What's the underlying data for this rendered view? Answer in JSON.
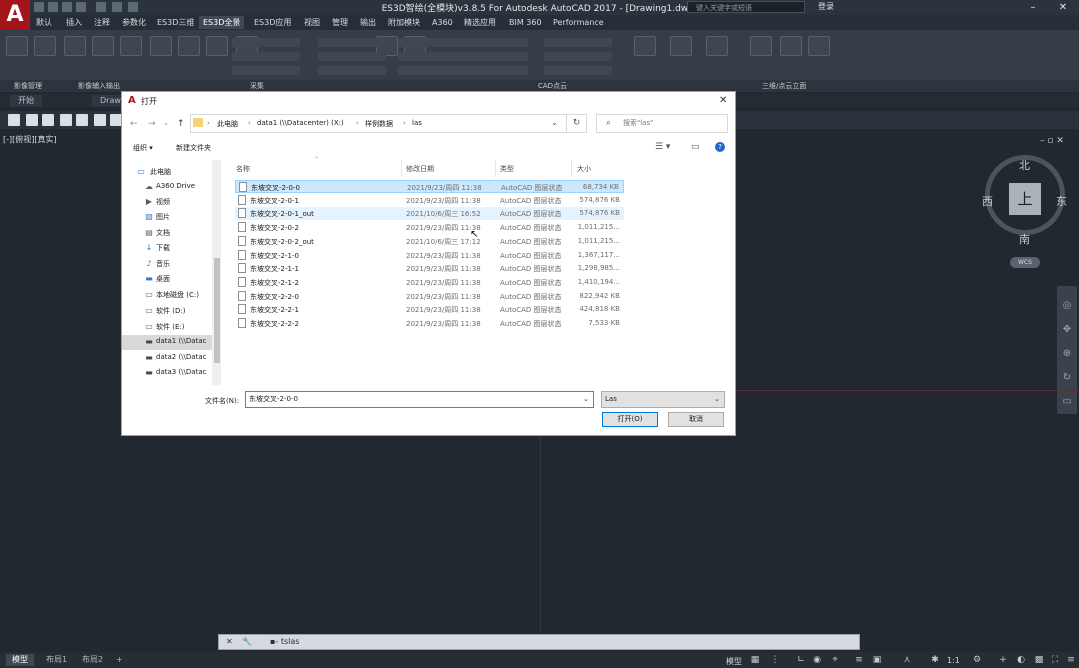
{
  "app": {
    "window_title": "ES3D智绘(全模块)v3.8.5 For Autodesk AutoCAD 2017 - [Drawing1.dwg]",
    "search_placeholder": "键入关键字或短语",
    "login_label": "登录",
    "logo_letter": "A"
  },
  "ribbon_tabs": [
    "默认",
    "插入",
    "注释",
    "参数化",
    "ES3D三维",
    "ES3D全景",
    "ES3D应用",
    "视图",
    "管理",
    "输出",
    "附加模块",
    "A360",
    "精选应用",
    "BIM 360",
    "Performance"
  ],
  "active_ribbon_tab": "ES3D全景",
  "ribbon_panels": [
    "影像管理",
    "影像辅入输出",
    "采集",
    "CAD点云",
    "三维/点云立面"
  ],
  "file_tabs": [
    "开始",
    "Drawing1"
  ],
  "viewport_label": "[-][俯视][真实]",
  "viewcube": {
    "face": "上",
    "north": "北",
    "south": "南",
    "east": "东",
    "west": "西",
    "wcs": "WCS"
  },
  "command_line": "▪- tslas",
  "status_tabs": [
    "模型",
    "布局1",
    "布局2",
    "+"
  ],
  "status_model_label": "模型",
  "status_scale": "1:1",
  "dialog": {
    "title": "打开",
    "breadcrumbs": [
      "此电脑",
      "data1 (\\\\Datacenter) (X:)",
      "样例数据",
      "las"
    ],
    "search_placeholder": "搜索\"las\"",
    "organize_label": "组织 ▾",
    "new_folder_label": "新建文件夹",
    "columns": {
      "name": "名称",
      "date": "修改日期",
      "type": "类型",
      "size": "大小"
    },
    "tree": [
      {
        "label": "此电脑",
        "icon": "computer-icon",
        "selected": false
      },
      {
        "label": "A360 Drive",
        "icon": "cloud-icon",
        "selected": false
      },
      {
        "label": "视频",
        "icon": "video-icon",
        "selected": false
      },
      {
        "label": "图片",
        "icon": "picture-icon",
        "selected": false
      },
      {
        "label": "文档",
        "icon": "document-icon",
        "selected": false
      },
      {
        "label": "下载",
        "icon": "download-icon",
        "selected": false
      },
      {
        "label": "音乐",
        "icon": "music-icon",
        "selected": false
      },
      {
        "label": "桌面",
        "icon": "desktop-icon",
        "selected": false
      },
      {
        "label": "本地磁盘 (C:)",
        "icon": "drive-icon",
        "selected": false
      },
      {
        "label": "软件 (D:)",
        "icon": "drive-icon",
        "selected": false
      },
      {
        "label": "软件 (E:)",
        "icon": "drive-icon",
        "selected": false
      },
      {
        "label": "data1 (\\\\Datac",
        "icon": "network-drive-icon",
        "selected": true
      },
      {
        "label": "data2 (\\\\Datac",
        "icon": "network-drive-icon",
        "selected": false
      },
      {
        "label": "data3 (\\\\Datac",
        "icon": "network-drive-icon",
        "selected": false
      }
    ],
    "files": [
      {
        "name": "东坡交叉-2-0-0",
        "date": "2021/9/23/周四 11:38",
        "type": "AutoCAD 图层状态",
        "size": "68,734 KB"
      },
      {
        "name": "东坡交叉-2-0-1",
        "date": "2021/9/23/周四 11:38",
        "type": "AutoCAD 图层状态",
        "size": "574,876 KB"
      },
      {
        "name": "东坡交叉-2-0-1_out",
        "date": "2021/10/6/周三 16:52",
        "type": "AutoCAD 图层状态",
        "size": "574,876 KB"
      },
      {
        "name": "东坡交叉-2-0-2",
        "date": "2021/9/23/周四 11:38",
        "type": "AutoCAD 图层状态",
        "size": "1,011,215..."
      },
      {
        "name": "东坡交叉-2-0-2_out",
        "date": "2021/10/6/周三 17:12",
        "type": "AutoCAD 图层状态",
        "size": "1,011,215..."
      },
      {
        "name": "东坡交叉-2-1-0",
        "date": "2021/9/23/周四 11:38",
        "type": "AutoCAD 图层状态",
        "size": "1,367,117..."
      },
      {
        "name": "东坡交叉-2-1-1",
        "date": "2021/9/23/周四 11:38",
        "type": "AutoCAD 图层状态",
        "size": "1,298,985..."
      },
      {
        "name": "东坡交叉-2-1-2",
        "date": "2021/9/23/周四 11:38",
        "type": "AutoCAD 图层状态",
        "size": "1,410,194..."
      },
      {
        "name": "东坡交叉-2-2-0",
        "date": "2021/9/23/周四 11:38",
        "type": "AutoCAD 图层状态",
        "size": "822,942 KB"
      },
      {
        "name": "东坡交叉-2-2-1",
        "date": "2021/9/23/周四 11:38",
        "type": "AutoCAD 图层状态",
        "size": "424,818 KB"
      },
      {
        "name": "东坡交叉-2-2-2",
        "date": "2021/9/23/周四 11:38",
        "type": "AutoCAD 图层状态",
        "size": "7,533 KB"
      }
    ],
    "filename_label": "文件名(N):",
    "filename_value": "东坡交叉-2-0-0",
    "filetype_value": "Las",
    "open_label": "打开(O)",
    "cancel_label": "取消"
  },
  "colors": {
    "accent": "#a3151b",
    "selection": "#cce8ff",
    "background": "#212830"
  }
}
